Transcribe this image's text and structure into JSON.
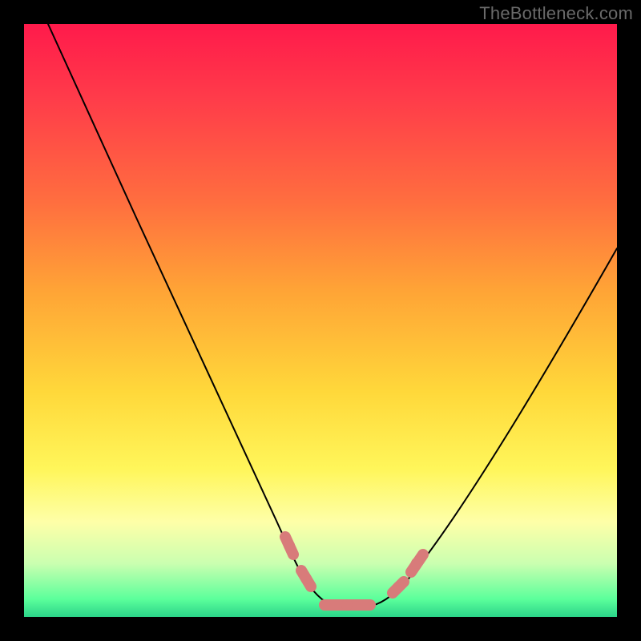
{
  "watermark": "TheBottleneck.com",
  "colors": {
    "frame": "#000000",
    "gradient_top": "#ff1a4b",
    "gradient_bottom": "#2bd489",
    "curve": "#000000",
    "marker": "#d87b7a"
  },
  "chart_data": {
    "type": "line",
    "title": "",
    "xlabel": "",
    "ylabel": "",
    "xlim": [
      0,
      100
    ],
    "ylim": [
      0,
      100
    ],
    "x": [
      0,
      5,
      10,
      15,
      20,
      25,
      30,
      35,
      40,
      45,
      48,
      50,
      52,
      54,
      56,
      58,
      60,
      62,
      65,
      70,
      75,
      80,
      85,
      90,
      95,
      100
    ],
    "values": [
      100,
      91,
      82,
      73,
      64,
      55,
      45,
      35,
      25,
      15,
      9,
      6,
      3,
      1.5,
      1,
      1,
      1.5,
      3,
      6,
      12,
      20,
      28,
      36,
      44,
      53,
      62
    ],
    "markers_x": [
      45,
      48,
      50,
      52,
      54,
      56,
      58,
      60,
      62,
      65
    ],
    "note": "V-shaped bottleneck curve. y represents bottleneck percentage (0 = no bottleneck / green, 100 = severe / red). Salmon markers highlight the flat optimal region near the minimum."
  }
}
